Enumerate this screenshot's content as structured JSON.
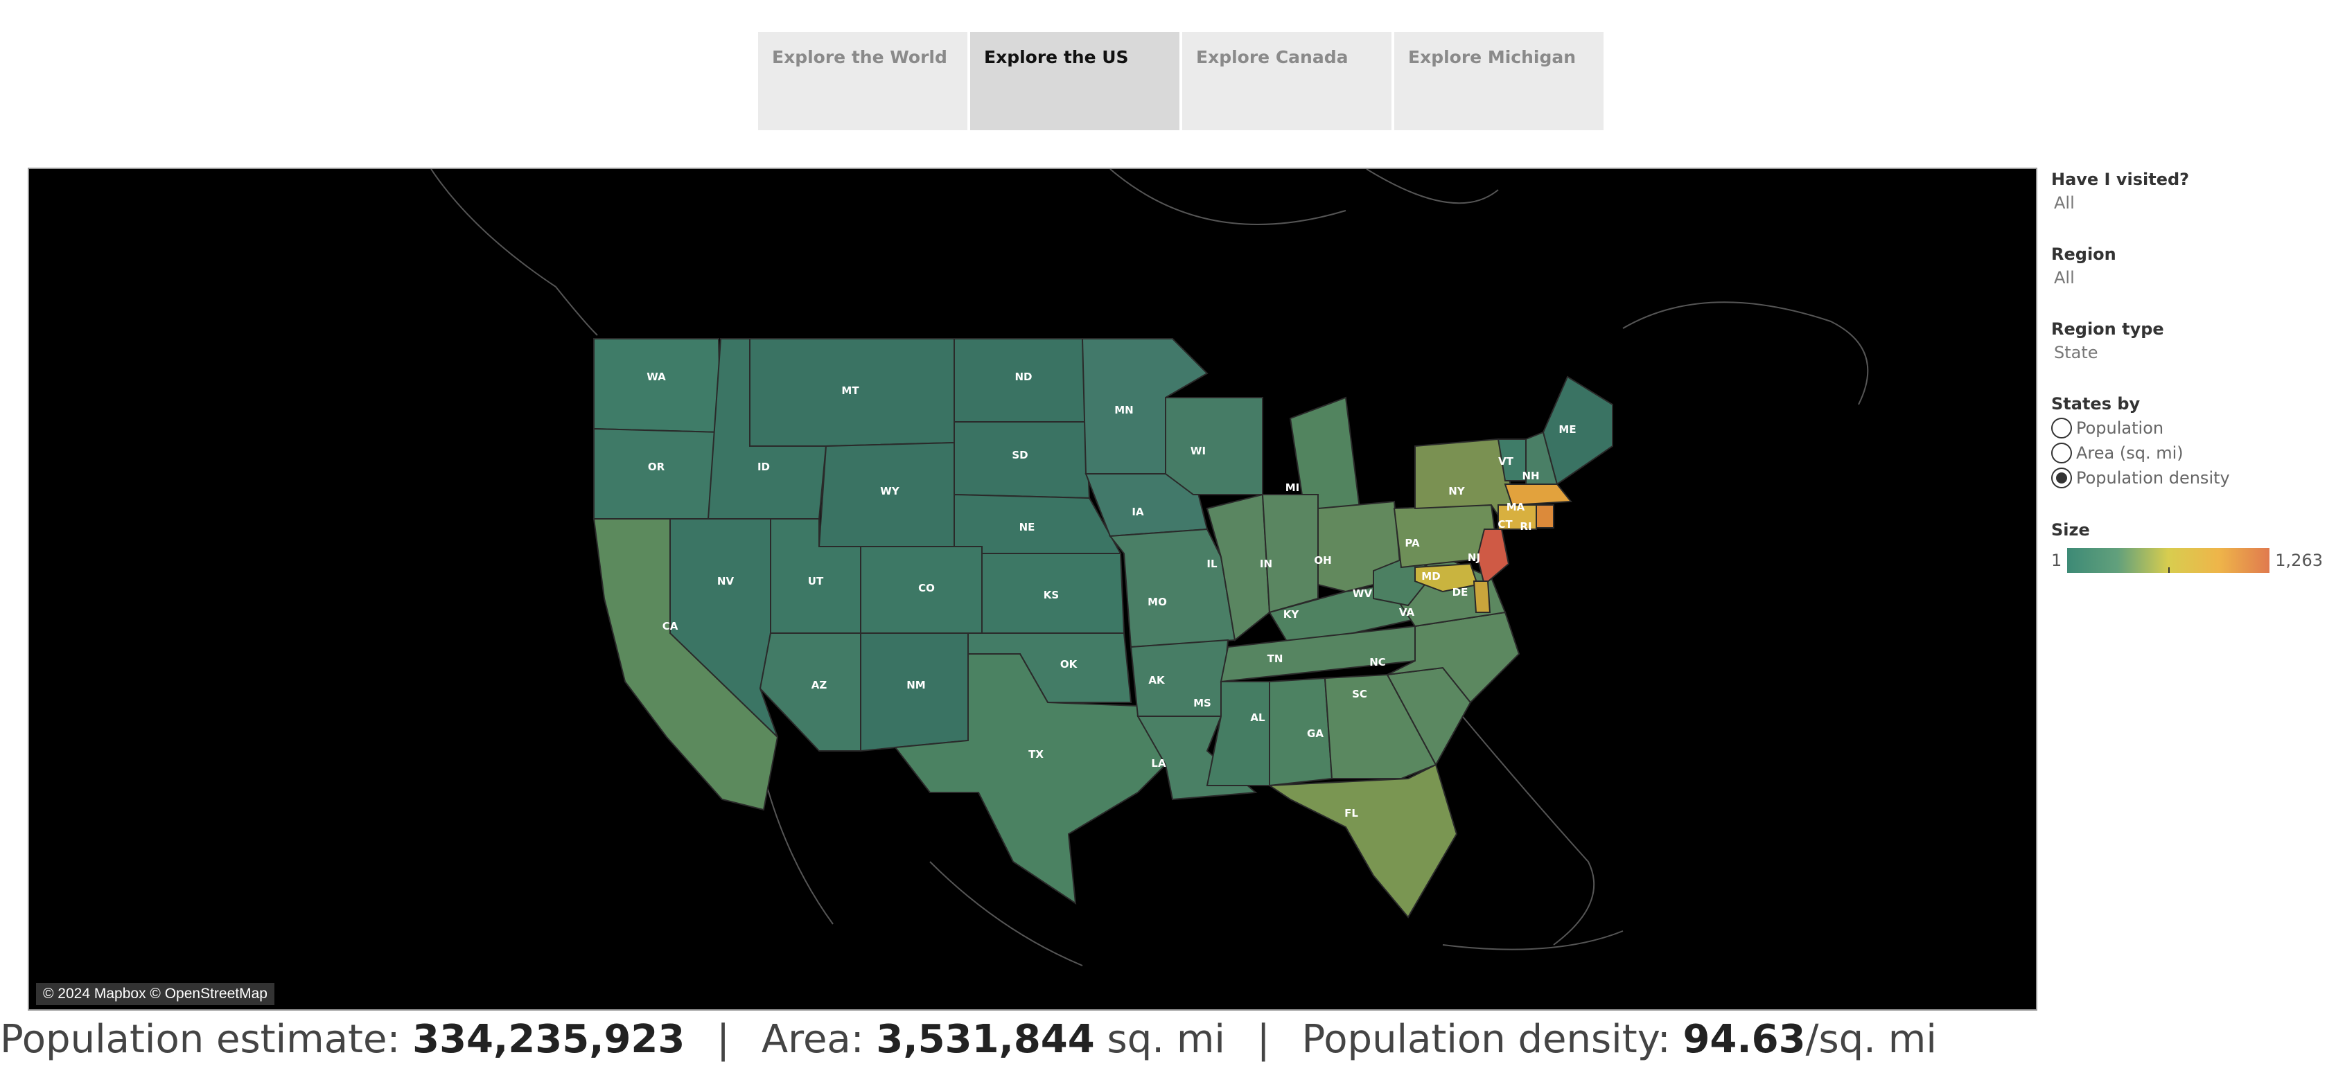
{
  "tabs": [
    {
      "label": "Explore the World",
      "active": false
    },
    {
      "label": "Explore the US",
      "active": true
    },
    {
      "label": "Explore Canada",
      "active": false
    },
    {
      "label": "Explore Michigan",
      "active": false
    }
  ],
  "map": {
    "attribution": "© 2024 Mapbox © OpenStreetMap",
    "states": [
      {
        "label": "WA",
        "fill": "#3f7c68"
      },
      {
        "label": "OR",
        "fill": "#3f7a67"
      },
      {
        "label": "CA",
        "fill": "#5c8a5d"
      },
      {
        "label": "ID",
        "fill": "#3b7564"
      },
      {
        "label": "NV",
        "fill": "#3b7564"
      },
      {
        "label": "MT",
        "fill": "#3a7363"
      },
      {
        "label": "WY",
        "fill": "#3a7363"
      },
      {
        "label": "UT",
        "fill": "#3d7865"
      },
      {
        "label": "AZ",
        "fill": "#427b66"
      },
      {
        "label": "CO",
        "fill": "#3d7865"
      },
      {
        "label": "NM",
        "fill": "#3a7363"
      },
      {
        "label": "ND",
        "fill": "#3a7363"
      },
      {
        "label": "SD",
        "fill": "#3a7363"
      },
      {
        "label": "NE",
        "fill": "#3b7564"
      },
      {
        "label": "KS",
        "fill": "#3d7865"
      },
      {
        "label": "OK",
        "fill": "#437c66"
      },
      {
        "label": "TX",
        "fill": "#4b8262"
      },
      {
        "label": "MN",
        "fill": "#42796a"
      },
      {
        "label": "IA",
        "fill": "#42796a"
      },
      {
        "label": "MO",
        "fill": "#4a7f66"
      },
      {
        "label": "AK",
        "fill": "#477d65"
      },
      {
        "label": "LA",
        "fill": "#4a8065"
      },
      {
        "label": "WI",
        "fill": "#467c66"
      },
      {
        "label": "IL",
        "fill": "#5a8661"
      },
      {
        "label": "MI",
        "fill": "#52845f"
      },
      {
        "label": "IN",
        "fill": "#5a8661"
      },
      {
        "label": "OH",
        "fill": "#62895d"
      },
      {
        "label": "KY",
        "fill": "#4f8261"
      },
      {
        "label": "TN",
        "fill": "#568561"
      },
      {
        "label": "MS",
        "fill": "#457d63"
      },
      {
        "label": "AL",
        "fill": "#4d8262"
      },
      {
        "label": "GA",
        "fill": "#5a8860"
      },
      {
        "label": "FL",
        "fill": "#7a9652"
      },
      {
        "label": "SC",
        "fill": "#5b8861"
      },
      {
        "label": "NC",
        "fill": "#5c8860"
      },
      {
        "label": "VA",
        "fill": "#5c8860"
      },
      {
        "label": "WV",
        "fill": "#4c8062"
      },
      {
        "label": "PA",
        "fill": "#6e8f58"
      },
      {
        "label": "NY",
        "fill": "#7a9152"
      },
      {
        "label": "VT",
        "fill": "#3f7c68"
      },
      {
        "label": "NH",
        "fill": "#4a7f66"
      },
      {
        "label": "ME",
        "fill": "#3a7363"
      },
      {
        "label": "MA",
        "fill": "#e2a23d"
      },
      {
        "label": "CT",
        "fill": "#d8b03f"
      },
      {
        "label": "RI",
        "fill": "#dc8a3a"
      },
      {
        "label": "NJ",
        "fill": "#cf5a45"
      },
      {
        "label": "MD",
        "fill": "#c9b43f"
      },
      {
        "label": "DE",
        "fill": "#caa53c"
      }
    ]
  },
  "filters": [
    {
      "title": "Have I visited?",
      "value": "All"
    },
    {
      "title": "Region",
      "value": "All"
    },
    {
      "title": "Region type",
      "value": "State"
    }
  ],
  "states_by": {
    "title": "States by",
    "options": [
      {
        "label": "Population",
        "selected": false
      },
      {
        "label": "Area (sq. mi)",
        "selected": false
      },
      {
        "label": "Population density",
        "selected": true
      }
    ]
  },
  "legend": {
    "title": "Size",
    "min": "1",
    "max": "1,263"
  },
  "summary": {
    "population_label": "Population estimate:",
    "population_value": "334,235,923",
    "area_label": "Area:",
    "area_value": "3,531,844",
    "area_unit": "sq. mi",
    "density_label": "Population density:",
    "density_value": "94.63",
    "density_unit": "/sq. mi",
    "separator": "|"
  }
}
